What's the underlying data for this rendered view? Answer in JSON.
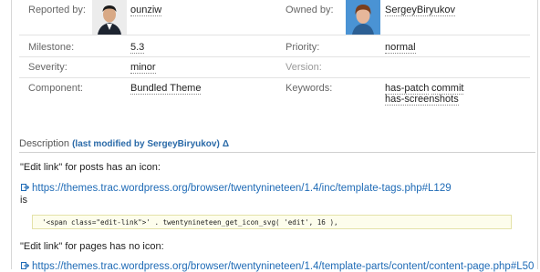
{
  "fields": {
    "reported_by": {
      "label": "Reported by:",
      "value": "ounziw"
    },
    "owned_by": {
      "label": "Owned by:",
      "value": "SergeyBiryukov"
    },
    "milestone": {
      "label": "Milestone:",
      "value": "5.3"
    },
    "priority": {
      "label": "Priority:",
      "value": "normal"
    },
    "severity": {
      "label": "Severity:",
      "value": "minor"
    },
    "version": {
      "label": "Version:",
      "value": ""
    },
    "component": {
      "label": "Component:",
      "value": "Bundled Theme"
    },
    "keywords": {
      "label": "Keywords:",
      "values": [
        "has-patch",
        "commit",
        "has-screenshots"
      ]
    }
  },
  "description": {
    "heading": "Description",
    "modified": "(last modified by SergeyBiryukov)",
    "delta": "Δ",
    "p1": "\"Edit link\" for posts has an icon:",
    "link1": "https://themes.trac.wordpress.org/browser/twentynineteen/1.4/inc/template-tags.php#L129",
    "is": "is",
    "code": "'<span class=\"edit-link\">' . twentynineteen_get_icon_svg( 'edit', 16 ),",
    "p2": "\"Edit link\" for pages has no icon:",
    "link2": "https://themes.trac.wordpress.org/browser/twentynineteen/1.4/template-parts/content/content-page.php#L50"
  },
  "colors": {
    "link": "#1f6bb6",
    "code_bg": "#fdfdec"
  }
}
